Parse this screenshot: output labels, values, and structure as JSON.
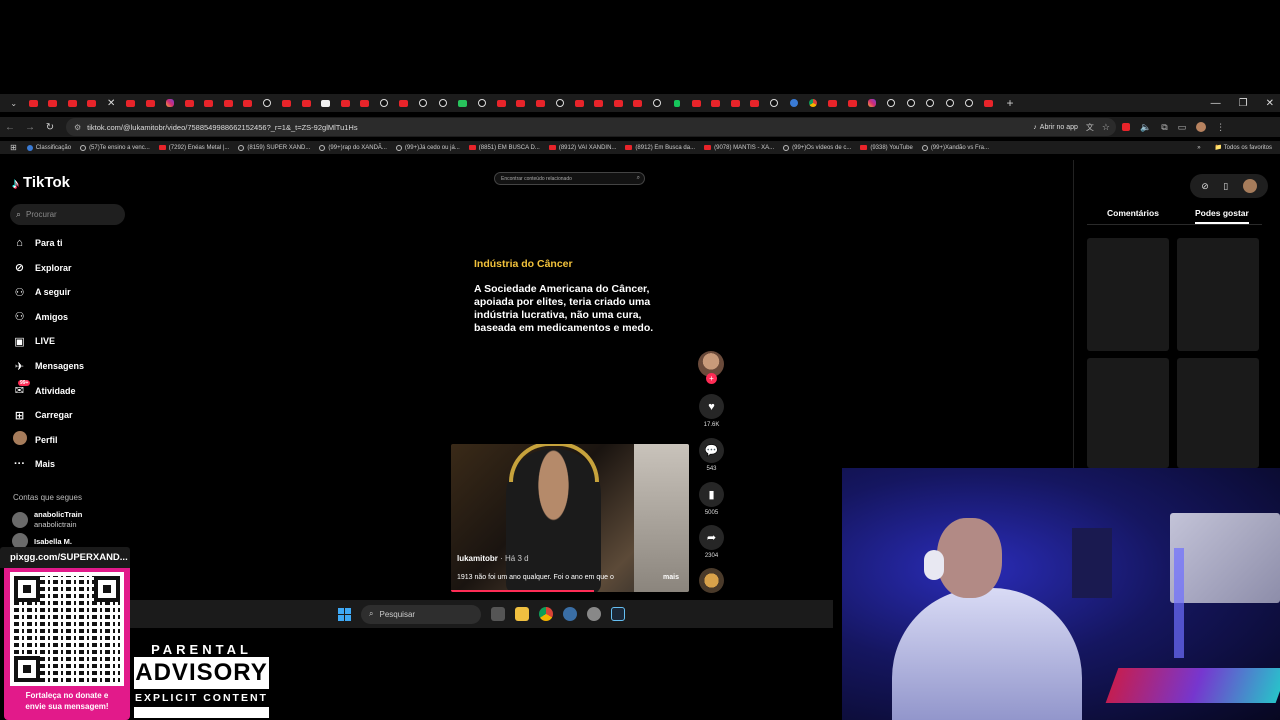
{
  "browser": {
    "tab_icons": [
      "yt",
      "yt",
      "yt",
      "yt",
      "yt",
      "yt",
      "ig",
      "yt",
      "yt",
      "yt",
      "yt",
      "tt",
      "yt",
      "yt",
      "wh",
      "yt",
      "yt",
      "tt",
      "yt",
      "tt",
      "tt",
      "gr",
      "tt",
      "yt",
      "yt",
      "yt",
      "tt",
      "yt",
      "yt",
      "yt",
      "yt",
      "tt",
      "k",
      "yt",
      "yt",
      "yt",
      "yt",
      "tt",
      "bl",
      "ch",
      "yt",
      "yt",
      "ig",
      "tt",
      "tt",
      "tt",
      "tt",
      "tt",
      "yt"
    ],
    "url": "tiktok.com/@lukamitobr/video/7588549988662152456?_r=1&_t=ZS-92glMlTu1Hs",
    "open_app_label": "Abrir no app",
    "bookmarks": [
      {
        "icon": "blue",
        "label": "Classificação"
      },
      {
        "icon": "tt",
        "label": "(57)Te ensino a venc..."
      },
      {
        "icon": "yt",
        "label": "(7292) Enéas Metal |..."
      },
      {
        "icon": "tt",
        "label": "(8159) SUPER XAND..."
      },
      {
        "icon": "tt",
        "label": "(99+)rap do XANDÃ..."
      },
      {
        "icon": "tt",
        "label": "(99+)Já cedo ou já..."
      },
      {
        "icon": "yt",
        "label": "(8851) EM BUSCA D..."
      },
      {
        "icon": "yt",
        "label": "(8912) VAI XANDIN..."
      },
      {
        "icon": "yt",
        "label": "(8912) Em Busca da..."
      },
      {
        "icon": "yt",
        "label": "(9078) MANTIS - XA..."
      },
      {
        "icon": "tt",
        "label": "(99+)Os vídeos de c..."
      },
      {
        "icon": "yt",
        "label": "(9338) YouTube"
      },
      {
        "icon": "tt",
        "label": "(99+)Xandão vs Fra..."
      }
    ],
    "all_favorites": "Todos os favoritos"
  },
  "tiktok": {
    "logo": "TikTok",
    "search_placeholder": "Procurar",
    "nav": [
      {
        "label": "Para ti",
        "icon": "home-icon"
      },
      {
        "label": "Explorar",
        "icon": "compass-icon"
      },
      {
        "label": "A seguir",
        "icon": "following-icon"
      },
      {
        "label": "Amigos",
        "icon": "friends-icon"
      },
      {
        "label": "LIVE",
        "icon": "live-icon"
      },
      {
        "label": "Mensagens",
        "icon": "messages-icon"
      },
      {
        "label": "Atividade",
        "icon": "activity-icon",
        "badge": "99+"
      },
      {
        "label": "Carregar",
        "icon": "upload-icon"
      },
      {
        "label": "Perfil",
        "icon": "profile-icon"
      },
      {
        "label": "Mais",
        "icon": "more-icon"
      }
    ],
    "following_title": "Contas que segues",
    "following": [
      {
        "name": "anabolicTrain",
        "handle": "anabolictrain"
      },
      {
        "name": "Isabella M.",
        "handle": ""
      }
    ],
    "related_search_placeholder": "Encontrar conteúdo relacionado",
    "video": {
      "title": "Indústria do Câncer",
      "text": "A Sociedade Americana do Câncer, apoiada por elites, teria criado uma indústria lucrativa, não uma cura, baseada em medicamentos e medo.",
      "author": "lukamitobr",
      "age": "· Há 3 d",
      "caption": "1913 não foi um ano qualquer. Foi o ano em que o",
      "more": "mais",
      "progress": 0.6
    },
    "actions": {
      "likes": "17.6K",
      "comments": "543",
      "saves": "5005",
      "shares": "2304"
    },
    "right_tabs": [
      "Comentários",
      "Podes gostar"
    ]
  },
  "taskbar": {
    "search_label": "Pesquisar"
  },
  "overlay": {
    "pix_label": "pixgg.com/SUPERXAND...",
    "donate_line1": "Fortaleça no donate e",
    "donate_line2": "envie sua mensagem!",
    "advisory_top": "PARENTAL",
    "advisory_mid": "ADVISORY",
    "advisory_bot": "EXPLICIT CONTENT"
  }
}
